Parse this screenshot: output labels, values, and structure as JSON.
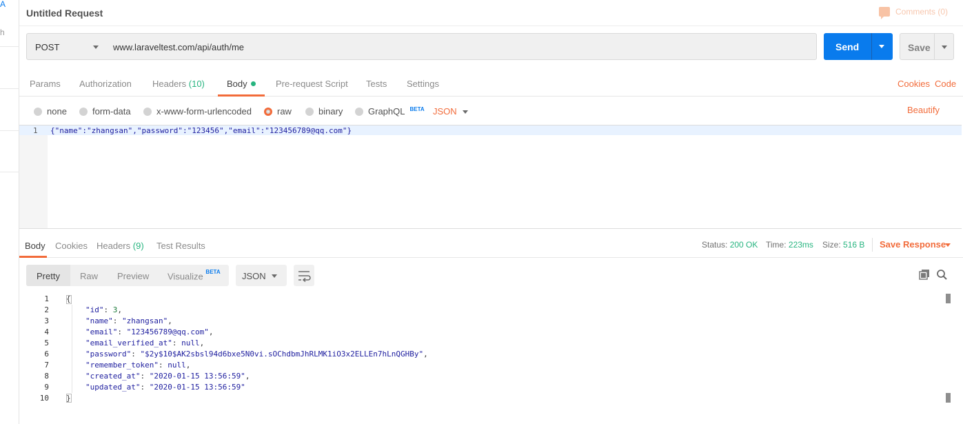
{
  "left_strip": {
    "top_letter": "A",
    "mid_letter": "h"
  },
  "title_bar": {
    "title": "Untitled Request",
    "comments": "Comments (0)"
  },
  "url_bar": {
    "method": "POST",
    "url": "www.laraveltest.com/api/auth/me",
    "send": "Send",
    "save": "Save"
  },
  "request_tabs": {
    "items": [
      {
        "label": "Params"
      },
      {
        "label": "Authorization"
      },
      {
        "label": "Headers",
        "count": "(10)"
      },
      {
        "label": "Body"
      },
      {
        "label": "Pre-request Script"
      },
      {
        "label": "Tests"
      },
      {
        "label": "Settings"
      }
    ],
    "cookies": "Cookies",
    "code": "Code"
  },
  "body_types": {
    "options": [
      "none",
      "form-data",
      "x-www-form-urlencoded",
      "raw",
      "binary",
      "GraphQL"
    ],
    "selected": "raw",
    "graphql_badge": "BETA",
    "format": "JSON",
    "beautify": "Beautify"
  },
  "request_editor": {
    "line_number": "1",
    "code": "{\"name\":\"zhangsan\",\"password\":\"123456\",\"email\":\"123456789@qq.com\"}"
  },
  "response_tabs": {
    "items": [
      {
        "label": "Body"
      },
      {
        "label": "Cookies"
      },
      {
        "label": "Headers",
        "count": "(9)"
      },
      {
        "label": "Test Results"
      }
    ],
    "status_label": "Status:",
    "status_value": "200 OK",
    "time_label": "Time:",
    "time_value": "223ms",
    "size_label": "Size:",
    "size_value": "516 B",
    "save_response": "Save Response"
  },
  "view_toolbar": {
    "pretty": "Pretty",
    "raw": "Raw",
    "preview": "Preview",
    "visualize": "Visualize",
    "visualize_badge": "BETA",
    "format": "JSON"
  },
  "response_body": {
    "line_numbers": [
      "1",
      "2",
      "3",
      "4",
      "5",
      "6",
      "7",
      "8",
      "9",
      "10"
    ],
    "open_brace": "{",
    "close_brace": "}",
    "id_key": "\"id\"",
    "id_val": "3",
    "name_key": "\"name\"",
    "name_val": "\"zhangsan\"",
    "email_key": "\"email\"",
    "email_val": "\"123456789@qq.com\"",
    "ev_key": "\"email_verified_at\"",
    "ev_val": "null",
    "pw_key": "\"password\"",
    "pw_val": "\"$2y$10$AK2sbsl94d6bxe5N0vi.sOChdbmJhRLMK1iO3x2ELLEn7hLnQGHBy\"",
    "rt_key": "\"remember_token\"",
    "rt_val": "null",
    "ca_key": "\"created_at\"",
    "ca_val": "\"2020-01-15 13:56:59\"",
    "ua_key": "\"updated_at\"",
    "ua_val": "\"2020-01-15 13:56:59\""
  },
  "colors": {
    "accent": "#f26b3a",
    "send": "#097bed",
    "success": "#26b47f"
  }
}
